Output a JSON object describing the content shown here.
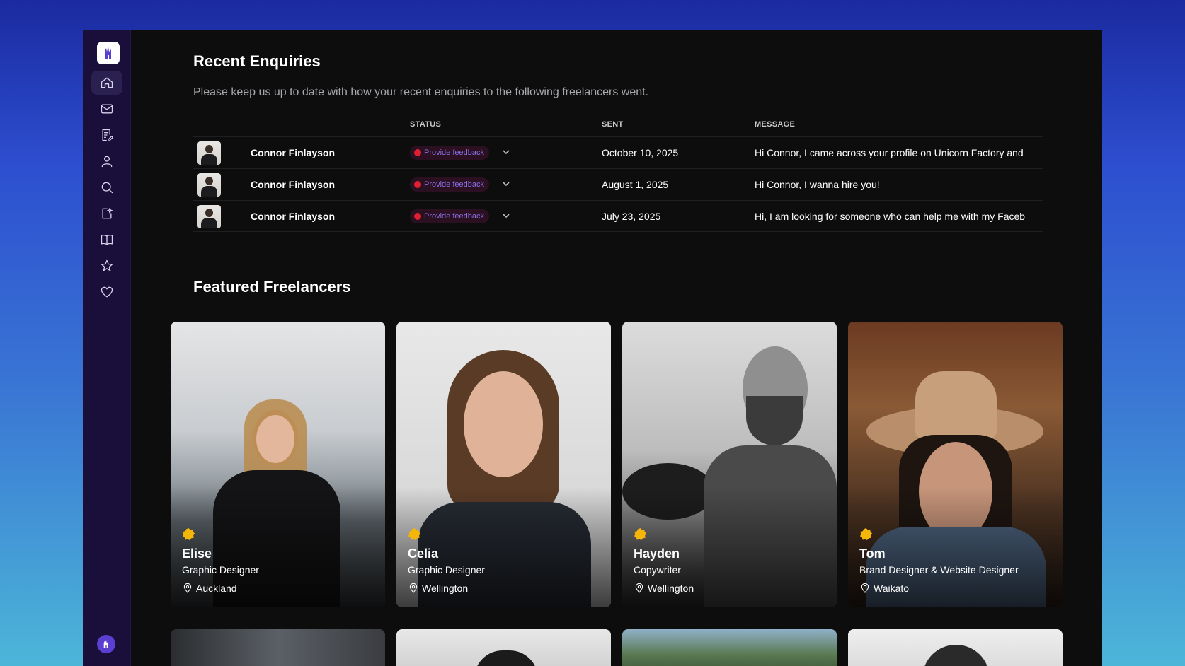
{
  "colors": {
    "accent": "#8a6fe8",
    "sidebar": "#1a0f3a",
    "status_dot": "#e02030",
    "badge": "#f5b60a"
  },
  "sidebar": {
    "items": [
      {
        "icon": "home-icon"
      },
      {
        "icon": "mail-icon"
      },
      {
        "icon": "notes-icon"
      },
      {
        "icon": "user-icon"
      },
      {
        "icon": "search-icon"
      },
      {
        "icon": "edit-sparkle-icon"
      },
      {
        "icon": "book-icon"
      },
      {
        "icon": "star-icon"
      },
      {
        "icon": "heart-icon"
      }
    ]
  },
  "enquiries": {
    "title": "Recent Enquiries",
    "subtitle": "Please keep us up to date with how your recent enquiries to the following freelancers went.",
    "columns": {
      "status": "STATUS",
      "sent": "SENT",
      "message": "MESSAGE"
    },
    "rows": [
      {
        "name": "Connor Finlayson",
        "status": "Provide feedback",
        "sent": "October 10, 2025",
        "message": "Hi Connor, I came across your profile on Unicorn Factory and"
      },
      {
        "name": "Connor Finlayson",
        "status": "Provide feedback",
        "sent": "August 1, 2025",
        "message": "Hi Connor, I wanna hire you!"
      },
      {
        "name": "Connor Finlayson",
        "status": "Provide feedback",
        "sent": "July 23, 2025",
        "message": "Hi, I am looking for someone who can help me with my Faceb"
      }
    ]
  },
  "featured": {
    "title": "Featured Freelancers",
    "cards": [
      {
        "name": "Elise",
        "role": "Graphic Designer",
        "location": "Auckland"
      },
      {
        "name": "Celia",
        "role": "Graphic Designer",
        "location": "Wellington"
      },
      {
        "name": "Hayden",
        "role": "Copywriter",
        "location": "Wellington"
      },
      {
        "name": "Tom",
        "role": "Brand Designer & Website Designer",
        "location": "Waikato"
      }
    ]
  }
}
